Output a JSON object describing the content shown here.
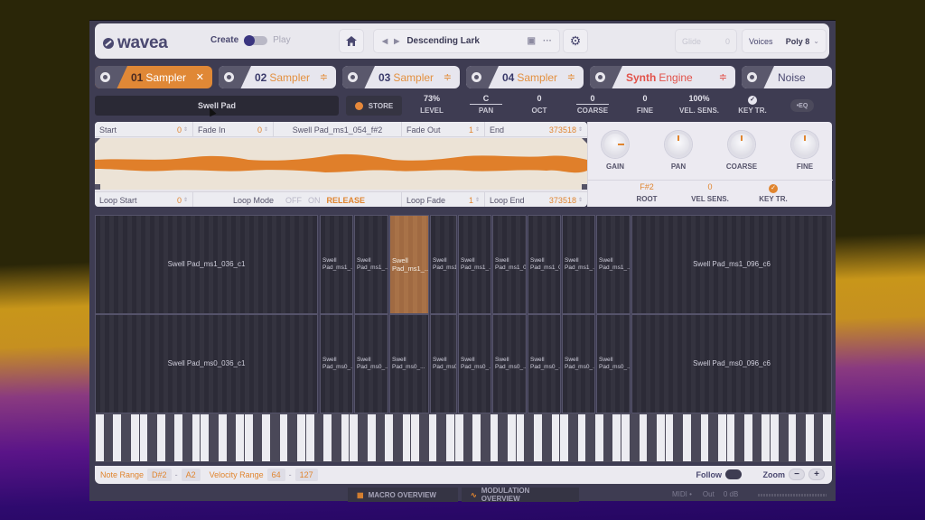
{
  "app": {
    "logo": "wavea"
  },
  "topbar": {
    "mode_create": "Create",
    "mode_play": "Play",
    "preset_name": "Descending Lark",
    "glide_label": "Glide",
    "glide_value": "0",
    "voices_label": "Voices",
    "voices_value": "Poly 8"
  },
  "tabs": [
    {
      "num": "01",
      "label": "Sampler",
      "selected": true,
      "action_icon": "close-icon"
    },
    {
      "num": "02",
      "label": "Sampler",
      "action_icon": "sliders-icon"
    },
    {
      "num": "03",
      "label": "Sampler",
      "action_icon": "sliders-icon"
    },
    {
      "num": "04",
      "label": "Sampler",
      "action_icon": "sliders-icon"
    },
    {
      "num": "Synth",
      "label": "Engine",
      "action_icon": "sliders-icon"
    },
    {
      "num": "",
      "label": "Noise"
    }
  ],
  "controls": {
    "sample_name": "Swell Pad",
    "store_label": "STORE",
    "params": [
      {
        "value": "73%",
        "label": "LEVEL"
      },
      {
        "value": "C",
        "label": "PAN"
      },
      {
        "value": "0",
        "label": "OCT"
      },
      {
        "value": "0",
        "label": "COARSE"
      },
      {
        "value": "0",
        "label": "FINE"
      },
      {
        "value": "100%",
        "label": "VEL. SENS."
      },
      {
        "value": "✓",
        "label": "KEY TR."
      }
    ],
    "eq_label": "EQ"
  },
  "wave": {
    "start_label": "Start",
    "start_value": "0",
    "fadein_label": "Fade In",
    "fadein_value": "0",
    "file_name": "Swell Pad_ms1_054_f#2",
    "fadeout_label": "Fade Out",
    "fadeout_value": "1",
    "end_label": "End",
    "end_value": "373518",
    "loopstart_label": "Loop Start",
    "loopstart_value": "0",
    "loopmode_label": "Loop Mode",
    "loopmode_options": [
      "OFF",
      "ON",
      "RELEASE"
    ],
    "loopmode_selected": "RELEASE",
    "loopfade_label": "Loop Fade",
    "loopfade_value": "1",
    "loopend_label": "Loop End",
    "loopend_value": "373518"
  },
  "knobs": [
    {
      "label": "GAIN"
    },
    {
      "label": "PAN"
    },
    {
      "label": "COARSE"
    },
    {
      "label": "FINE"
    }
  ],
  "sample_props": [
    {
      "value": "F#2",
      "label": "ROOT"
    },
    {
      "value": "0",
      "label": "VEL SENS."
    },
    {
      "value": "✓",
      "label": "KEY TR."
    }
  ],
  "zones": {
    "top": [
      "Swell Pad_ms1_036_c1",
      "Swell Pad_ms1_...",
      "Swell Pad_ms1_...",
      "Swell Pad_ms1_...",
      "Swell Pad_ms1_...",
      "Swell Pad_ms1_...",
      "Swell Pad_ms1_0...",
      "Swell Pad_ms1_0...",
      "Swell Pad_ms1_...",
      "Swell Pad_ms1_...",
      "Swell Pad_ms1_096_c6"
    ],
    "bottom": [
      "Swell Pad_ms0_036_c1",
      "Swell Pad_ms0_...",
      "Swell Pad_ms0_...",
      "Swell Pad_ms0_...",
      "Swell Pad_ms0_...",
      "Swell Pad_ms0_...",
      "Swell Pad_ms0_...",
      "Swell Pad_ms0_...",
      "Swell Pad_ms0_...",
      "Swell Pad_ms0_...",
      "Swell Pad_ms0_096_c6"
    ],
    "selected_top_index": 3
  },
  "footer": {
    "note_range_label": "Note Range",
    "note_low": "D#2",
    "note_high": "A2",
    "velocity_range_label": "Velocity Range",
    "vel_low": "64",
    "vel_high": "127",
    "follow_label": "Follow",
    "zoom_label": "Zoom",
    "zoom_out": "−",
    "zoom_in": "+"
  },
  "bottombar": {
    "macro_label": "MACRO OVERVIEW",
    "modulation_label": "MODULATION OVERVIEW",
    "midi_label": "MIDI",
    "out_label": "Out",
    "out_value": "0 dB"
  },
  "colors": {
    "accent": "#e08836",
    "synth": "#e2524a",
    "brand": "#4a4870"
  }
}
